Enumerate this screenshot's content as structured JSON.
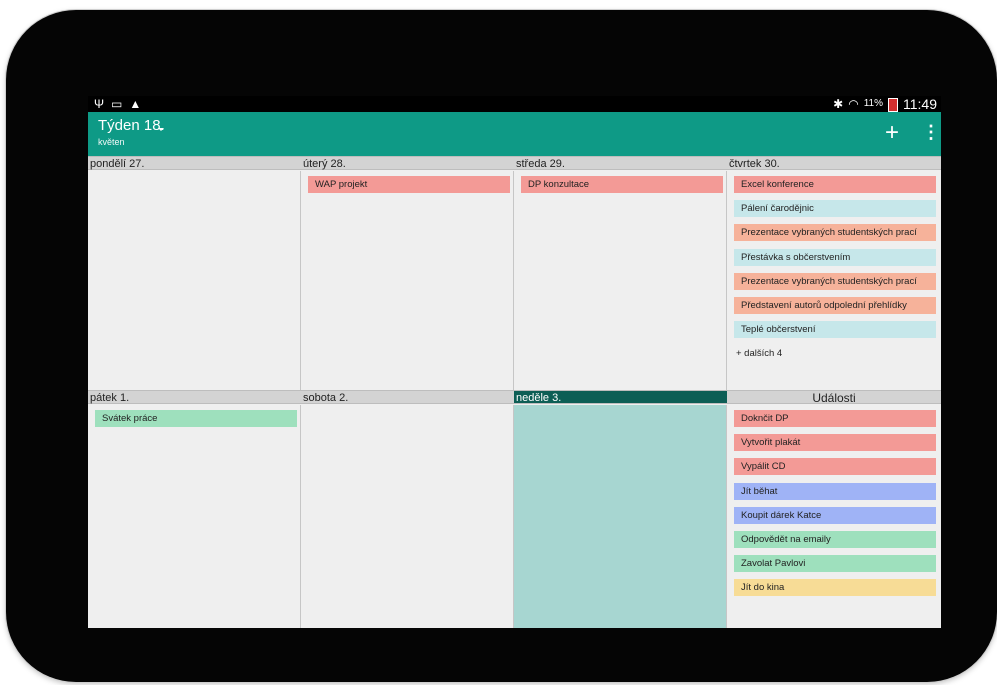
{
  "status_bar": {
    "left_icons": [
      "usb-icon",
      "screen-cast-icon",
      "warning-icon"
    ],
    "right_icons": [
      "bluetooth-icon",
      "wifi-icon"
    ],
    "battery_percent": "11%",
    "battery_level": 0.11,
    "time": "11:49"
  },
  "action_bar": {
    "title": "Týden 18.",
    "subtitle": "květen",
    "add_icon": "+",
    "menu_icon": "⋮"
  },
  "colors": {
    "action_bar": "#0e9a86",
    "today_header": "#0c5e55",
    "today_cell": "#a7d6d1",
    "red": "#f39a96",
    "cyan": "#c6e7ea",
    "orange": "#f6b29a",
    "green": "#9ee0bd",
    "blue": "#9fb3f6",
    "yellow": "#f7dc96"
  },
  "days": [
    {
      "label": "pondělí 27.",
      "events": []
    },
    {
      "label": "úterý 28.",
      "events": [
        {
          "text": "WAP projekt",
          "color": "#f39a96"
        }
      ]
    },
    {
      "label": "středa 29.",
      "events": [
        {
          "text": "DP konzultace",
          "color": "#f39a96"
        }
      ]
    },
    {
      "label": "čtvrtek 30.",
      "events": [
        {
          "text": "Excel konference",
          "color": "#f39a96"
        },
        {
          "text": "Pálení čarodějnic",
          "color": "#c6e7ea"
        },
        {
          "text": "Prezentace vybraných studentských prací",
          "color": "#f6b29a"
        },
        {
          "text": "Přestávka s občerstvením",
          "color": "#c6e7ea"
        },
        {
          "text": "Prezentace vybraných studentských prací",
          "color": "#f6b29a"
        },
        {
          "text": "Představení autorů odpolední přehlídky",
          "color": "#f6b29a"
        },
        {
          "text": "Teplé občerstvení",
          "color": "#c6e7ea"
        }
      ],
      "more": "+ dalších 4"
    },
    {
      "label": "pátek 1.",
      "events": [
        {
          "text": "Svátek práce",
          "color": "#9ee0bd"
        }
      ]
    },
    {
      "label": "sobota 2.",
      "events": []
    },
    {
      "label": "neděle 3.",
      "events": [],
      "today": true
    }
  ],
  "tasks": {
    "header": "Události",
    "items": [
      {
        "text": "Doknčit DP",
        "color": "#f39a96"
      },
      {
        "text": "Vytvořit plakát",
        "color": "#f39a96"
      },
      {
        "text": "Vypálit CD",
        "color": "#f39a96"
      },
      {
        "text": "Jít běhat",
        "color": "#9fb3f6"
      },
      {
        "text": "Koupit dárek Katce",
        "color": "#9fb3f6"
      },
      {
        "text": "Odpovědět na emaily",
        "color": "#9ee0bd"
      },
      {
        "text": "Zavolat Pavlovi",
        "color": "#9ee0bd"
      },
      {
        "text": "Jít do kina",
        "color": "#f7dc96"
      }
    ]
  }
}
